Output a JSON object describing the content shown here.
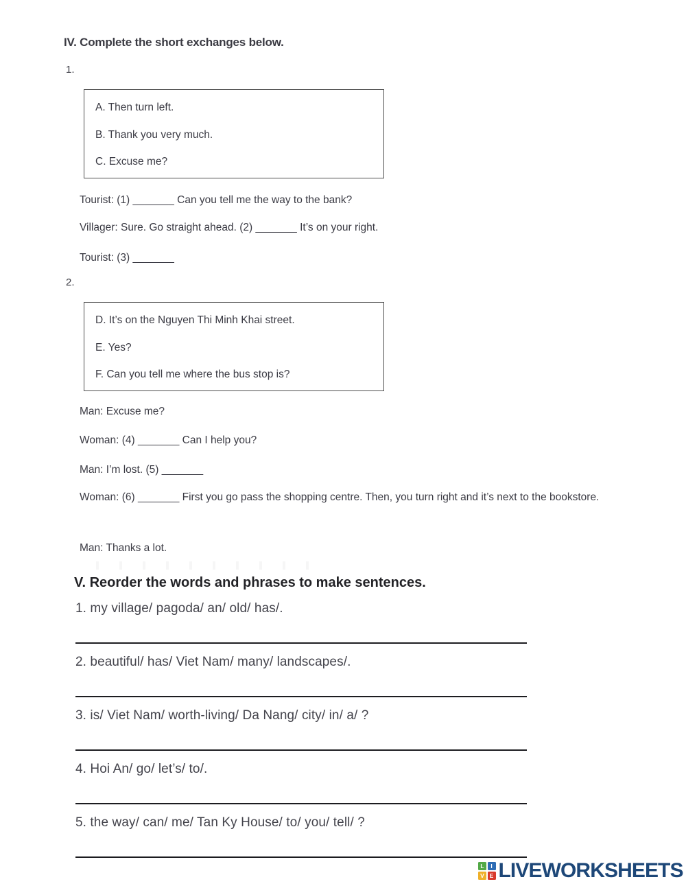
{
  "section_iv": {
    "heading": "IV. Complete the short exchanges below.",
    "exercises": [
      {
        "number": "1.",
        "choices": [
          "A. Then turn left.",
          "B. Thank you very much.",
          "C. Excuse me?"
        ],
        "dialogue": [
          "Tourist: (1) _______ Can you tell me the way to the bank?",
          "Villager: Sure. Go straight ahead. (2) _______ It’s on your right.",
          "Tourist: (3) _______"
        ]
      },
      {
        "number": "2.",
        "choices": [
          "D. It’s on the Nguyen Thi Minh Khai street.",
          "E. Yes?",
          "F. Can you tell me where the bus stop is?"
        ],
        "dialogue": [
          "Man: Excuse me?",
          "Woman: (4) _______ Can I help you?",
          "Man: I’m lost. (5) _______",
          "Woman: (6) _______ First you go pass the shopping centre. Then, you turn right and it’s next to the bookstore.",
          "Man: Thanks a lot."
        ]
      }
    ]
  },
  "section_v": {
    "heading": "V. Reorder the words and phrases to make sentences.",
    "items": [
      "1. my village/ pagoda/ an/ old/ has/.",
      "2. beautiful/ has/ Viet Nam/ many/ landscapes/.",
      "3. is/ Viet Nam/ worth-living/ Da Nang/ city/ in/ a/ ?",
      "4. Hoi An/ go/ let’s/ to/.",
      "5. the way/ can/ me/ Tan Ky House/ to/ you/ tell/ ?"
    ]
  },
  "logo": {
    "tiles": [
      "L",
      "I",
      "V",
      "E"
    ],
    "wordmark": "LIVEWORKSHEETS",
    "colors": {
      "tile_l": "#53a947",
      "tile_i": "#2d6cb5",
      "tile_v": "#efb02a",
      "tile_e": "#d8392b",
      "wordmark": "#1d4778"
    }
  }
}
